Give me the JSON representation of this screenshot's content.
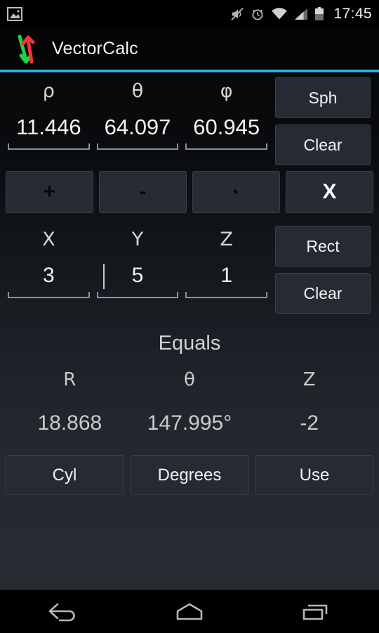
{
  "status_bar": {
    "time": "17:45",
    "icons": [
      {
        "name": "gallery-icon",
        "position": "left"
      },
      {
        "name": "volume-mute-icon",
        "position": "right"
      },
      {
        "name": "alarm-clock-icon",
        "position": "right"
      },
      {
        "name": "wifi-icon",
        "position": "right"
      },
      {
        "name": "cellular-signal-icon",
        "position": "right"
      },
      {
        "name": "battery-icon",
        "position": "right"
      }
    ]
  },
  "action_bar": {
    "title": "VectorCalc",
    "icon": "vector-arrows-icon",
    "accent_color": "#33b5e5"
  },
  "spherical": {
    "mode_label": "Sph",
    "clear_label": "Clear",
    "fields": [
      {
        "label": "ρ",
        "value": "11.446"
      },
      {
        "label": "θ",
        "value": "64.097"
      },
      {
        "label": "φ",
        "value": "60.945"
      }
    ]
  },
  "operators": [
    {
      "label": "+",
      "name": "add",
      "active": false
    },
    {
      "label": "-",
      "name": "subtract",
      "active": false
    },
    {
      "label": "·",
      "name": "dot-product",
      "active": false
    },
    {
      "label": "X",
      "name": "cross-product",
      "active": true
    }
  ],
  "rectangular": {
    "mode_label": "Rect",
    "clear_label": "Clear",
    "fields": [
      {
        "label": "X",
        "value": "3",
        "focused": false
      },
      {
        "label": "Y",
        "value": "5",
        "focused": true
      },
      {
        "label": "Z",
        "value": "1",
        "focused": false
      }
    ]
  },
  "result": {
    "equals_label": "Equals",
    "columns": [
      {
        "header": "R",
        "value": "18.868"
      },
      {
        "header": "θ",
        "value": "147.995°"
      },
      {
        "header": "Z",
        "value": "-2"
      }
    ]
  },
  "bottom_buttons": [
    {
      "label": "Cyl",
      "name": "cylindrical-mode-button"
    },
    {
      "label": "Degrees",
      "name": "degrees-toggle-button"
    },
    {
      "label": "Use",
      "name": "use-result-button"
    }
  ],
  "nav_bar": {
    "buttons": [
      {
        "name": "back-icon"
      },
      {
        "name": "home-icon"
      },
      {
        "name": "recents-icon"
      }
    ]
  }
}
